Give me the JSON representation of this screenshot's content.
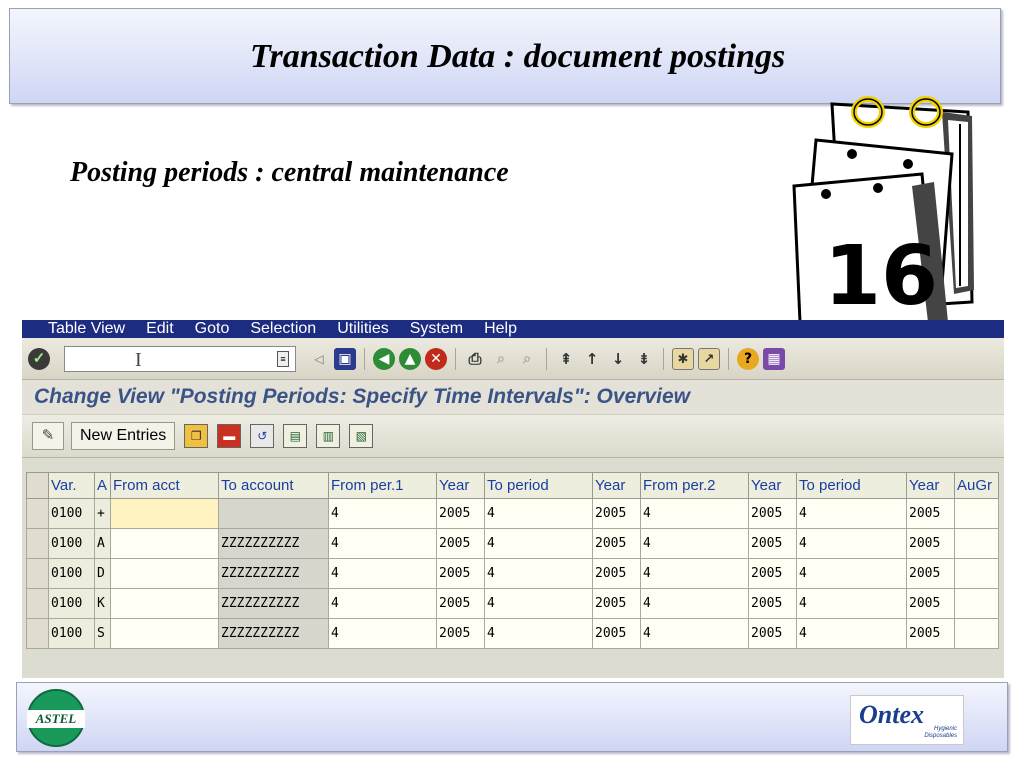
{
  "slide": {
    "title": "Transaction Data : document postings",
    "subtitle": "Posting periods : central maintenance",
    "calendar_number": "16"
  },
  "sap": {
    "menu": [
      "Table View",
      "Edit",
      "Goto",
      "Selection",
      "Utilities",
      "System",
      "Help"
    ],
    "command_field": {
      "value": "",
      "cursor": "I"
    },
    "screen_title": "Change View \"Posting Periods: Specify Time Intervals\": Overview",
    "app_toolbar": {
      "new_entries_label": "New Entries"
    },
    "table": {
      "columns": [
        "Var.",
        "A",
        "From acct",
        "To account",
        "From per.1",
        "Year",
        "To period",
        "Year",
        "From per.2",
        "Year",
        "To period",
        "Year",
        "AuGr"
      ],
      "rows": [
        [
          "0100",
          "+",
          "",
          "",
          "4",
          "2005",
          "4",
          "2005",
          "4",
          "2005",
          "4",
          "2005",
          ""
        ],
        [
          "0100",
          "A",
          "",
          "ZZZZZZZZZZ",
          "4",
          "2005",
          "4",
          "2005",
          "4",
          "2005",
          "4",
          "2005",
          ""
        ],
        [
          "0100",
          "D",
          "",
          "ZZZZZZZZZZ",
          "4",
          "2005",
          "4",
          "2005",
          "4",
          "2005",
          "4",
          "2005",
          ""
        ],
        [
          "0100",
          "K",
          "",
          "ZZZZZZZZZZ",
          "4",
          "2005",
          "4",
          "2005",
          "4",
          "2005",
          "4",
          "2005",
          ""
        ],
        [
          "0100",
          "S",
          "",
          "ZZZZZZZZZZ",
          "4",
          "2005",
          "4",
          "2005",
          "4",
          "2005",
          "4",
          "2005",
          ""
        ]
      ]
    }
  },
  "footer": {
    "left_logo": "ASTEL",
    "right_logo": "Ontex",
    "right_logo_tagline_1": "Hygienic",
    "right_logo_tagline_2": "Disposables"
  },
  "colors": {
    "menubar": "#1c2c80",
    "screen_title": "#3a5488",
    "column_header": "#1a3ea0",
    "banner_gradient_end": "#cfd6f4"
  },
  "icons": [
    "enter-check-icon",
    "command-history-icon",
    "back-arrow-icon",
    "save-icon",
    "back-nav-icon",
    "exit-nav-icon",
    "cancel-nav-icon",
    "print-icon",
    "find-icon",
    "find-next-icon",
    "first-page-icon",
    "previous-page-icon",
    "next-page-icon",
    "last-page-icon",
    "create-session-icon",
    "shortcut-icon",
    "help-icon",
    "layout-icon",
    "display-change-icon",
    "copy-icon",
    "delete-icon",
    "undo-icon",
    "select-all-icon",
    "select-block-icon",
    "deselect-all-icon"
  ]
}
